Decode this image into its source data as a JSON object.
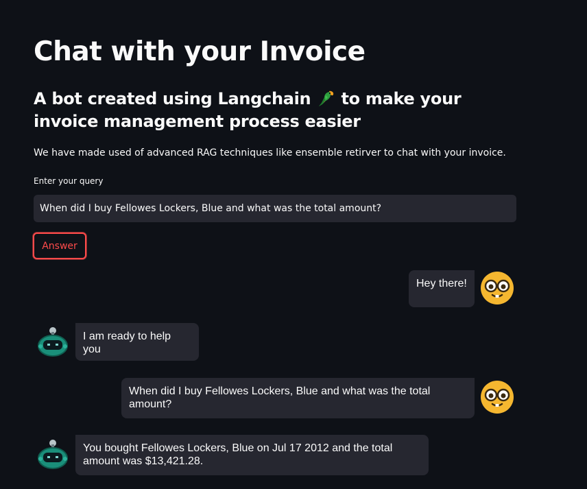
{
  "header": {
    "title": "Chat with your Invoice",
    "subtitle_part1": "A bot created using Langchain",
    "subtitle_icon": "parrot-icon",
    "subtitle_part2": "to make your invoice management process easier",
    "description": "We have made used of advanced RAG techniques like ensemble retirver to chat with your invoice."
  },
  "query": {
    "label": "Enter your query",
    "value": "When did I buy Fellowes Lockers, Blue and what was the total amount?"
  },
  "answer_button": {
    "label": "Answer"
  },
  "chat": {
    "messages": [
      {
        "role": "user",
        "avatar": "nerd-face-icon",
        "text": "Hey there!"
      },
      {
        "role": "bot",
        "avatar": "robot-icon",
        "text": "I am ready to help you"
      },
      {
        "role": "user",
        "avatar": "nerd-face-icon",
        "text": "When did I buy Fellowes Lockers, Blue and what was the total amount?"
      },
      {
        "role": "bot",
        "avatar": "robot-icon",
        "text": "You bought Fellowes Lockers, Blue on Jul 17 2012 and the total amount was $13,421.28."
      }
    ]
  },
  "colors": {
    "background": "#0e1117",
    "surface": "#262730",
    "accent": "#ff4b4b",
    "text": "#fafafa"
  }
}
